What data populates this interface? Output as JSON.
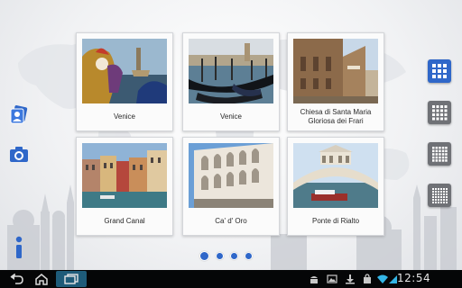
{
  "theme": {
    "accent": "#2f67c9",
    "nav_background": "#050607"
  },
  "sidebar_left": [
    {
      "icon": "album-icon"
    },
    {
      "icon": "camera-icon"
    },
    {
      "icon": "info-icon"
    }
  ],
  "sidebar_right": [
    {
      "icon": "grid-3x3-icon",
      "state": "active"
    },
    {
      "icon": "grid-icon",
      "state": "inactive"
    },
    {
      "icon": "grid-icon",
      "state": "inactive"
    },
    {
      "icon": "grid-icon",
      "state": "inactive"
    }
  ],
  "gallery": {
    "cards": [
      {
        "caption": "Venice",
        "photo": "venice-carnival-masks"
      },
      {
        "caption": "Venice",
        "photo": "venice-gondolas"
      },
      {
        "caption": "Chiesa di Santa Maria Gloriosa dei Frari",
        "photo": "frari-church"
      },
      {
        "caption": "Grand Canal",
        "photo": "grand-canal-houses"
      },
      {
        "caption": "Ca' d' Oro",
        "photo": "ca-d-oro-palace"
      },
      {
        "caption": "Ponte di Rialto",
        "photo": "rialto-bridge"
      }
    ]
  },
  "pager": {
    "pages": 4,
    "current": 1
  },
  "navbar": {
    "buttons": [
      "back-icon",
      "home-icon",
      "recent-apps-icon"
    ],
    "status_icons": [
      "android-icon",
      "image-icon",
      "download-icon",
      "bag-icon",
      "wifi-icon",
      "signal-icon"
    ],
    "time": "12:54"
  }
}
